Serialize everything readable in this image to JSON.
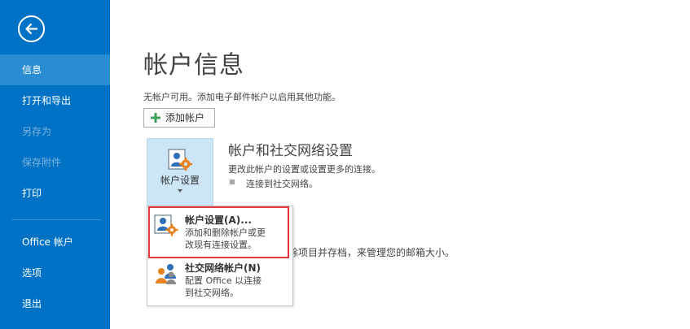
{
  "sidebar": {
    "items": [
      {
        "label": "信息",
        "state": "selected"
      },
      {
        "label": "打开和导出",
        "state": "normal"
      },
      {
        "label": "另存为",
        "state": "disabled"
      },
      {
        "label": "保存附件",
        "state": "disabled"
      },
      {
        "label": "打印",
        "state": "normal"
      },
      {
        "label": "Office 帐户",
        "state": "normal"
      },
      {
        "label": "选项",
        "state": "normal"
      },
      {
        "label": "退出",
        "state": "normal"
      }
    ]
  },
  "main": {
    "title": "帐户信息",
    "no_account_text": "无帐户可用。添加电子邮件帐户以启用其他功能。",
    "add_account_label": "添加帐户",
    "account_settings": {
      "button_label": "帐户设置",
      "section_title": "帐户和社交网络设置",
      "section_desc": "更改此帐户的设置或设置更多的连接。",
      "bullet_text": "连接到社交网络。"
    },
    "mailbox_text": "除项目并存档，来管理您的邮箱大小。"
  },
  "dropdown": {
    "items": [
      {
        "title": "帐户设置(A)...",
        "desc_line1": "添加和删除帐户或更",
        "desc_line2": "改现有连接设置。"
      },
      {
        "title": "社交网络帐户(N)",
        "desc_line1": "配置 Office 以连接",
        "desc_line2": "到社交网络。"
      }
    ]
  },
  "colors": {
    "sidebar_bg": "#0072c6",
    "sidebar_selected": "#2a8dd4",
    "highlight": "#e0393e",
    "button_hover": "#cde6f7",
    "gear": "#e8821e"
  }
}
